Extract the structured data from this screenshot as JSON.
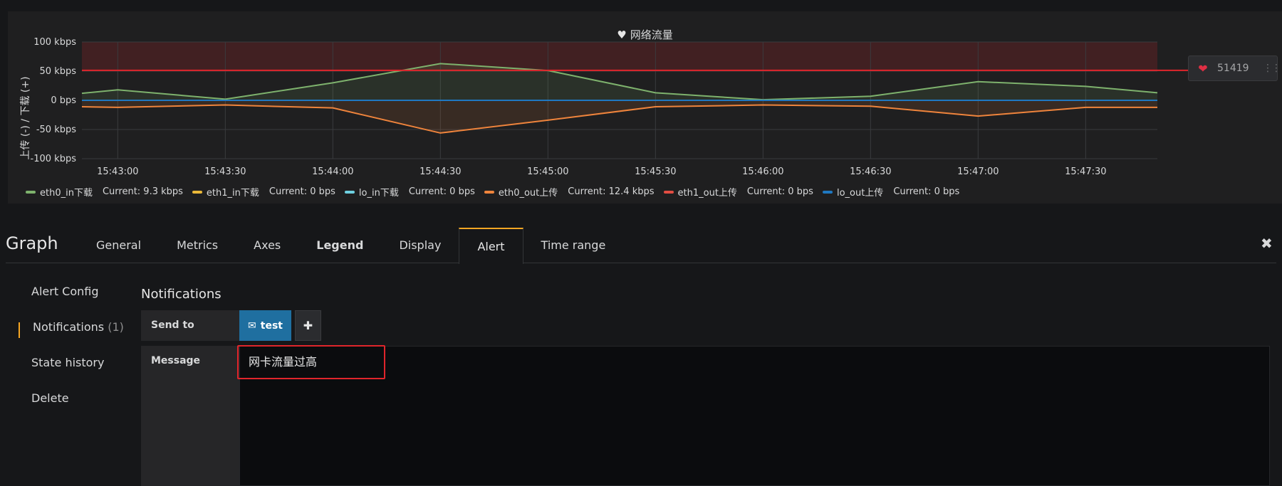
{
  "panel": {
    "title": "网络流量",
    "title_icon": "heart-icon",
    "y_axis_label": "上传 (-) / 下载 (+)",
    "threshold_handle": {
      "value": "51419",
      "icon": "broken-heart-icon"
    }
  },
  "chart_data": {
    "type": "line",
    "title": "网络流量",
    "ylabel": "上传 (-) / 下载 (+)",
    "xlabel": "",
    "ylim": [
      -100,
      100
    ],
    "y_ticks": [
      {
        "value": 100,
        "label": "100 kbps"
      },
      {
        "value": 50,
        "label": "50 kbps"
      },
      {
        "value": 0,
        "label": "0 bps"
      },
      {
        "value": -50,
        "label": "-50 kbps"
      },
      {
        "value": -100,
        "label": "-100 kbps"
      }
    ],
    "x_ticks": [
      "15:43:00",
      "15:43:30",
      "15:44:00",
      "15:44:30",
      "15:45:00",
      "15:45:30",
      "15:46:00",
      "15:46:30",
      "15:47:00",
      "15:47:30"
    ],
    "x_points": [
      "15:42:50",
      "15:43:00",
      "15:43:30",
      "15:44:00",
      "15:44:30",
      "15:45:00",
      "15:45:30",
      "15:46:00",
      "15:46:30",
      "15:47:00",
      "15:47:30",
      "15:47:50"
    ],
    "threshold": 51.4,
    "threshold_color": "#e0252b",
    "grid": true,
    "legend_position": "bottom",
    "series": [
      {
        "name": "eth0_in下载",
        "color": "#7eb26d",
        "current": "Current: 9.3 kbps",
        "fill": true,
        "values": [
          12,
          18,
          2,
          30,
          63,
          51,
          13,
          1,
          7,
          32,
          24,
          13
        ]
      },
      {
        "name": "eth1_in下载",
        "color": "#eab839",
        "current": "Current: 0 bps",
        "fill": false,
        "values": [
          0,
          0,
          0,
          0,
          0,
          0,
          0,
          0,
          0,
          0,
          0,
          0
        ]
      },
      {
        "name": "lo_in下载",
        "color": "#6ed0e0",
        "current": "Current: 0 bps",
        "fill": false,
        "values": [
          0,
          0,
          0,
          0,
          0,
          0,
          0,
          0,
          0,
          0,
          0,
          0
        ]
      },
      {
        "name": "eth0_out上传",
        "color": "#ef843c",
        "current": "Current: 12.4 kbps",
        "fill": true,
        "values": [
          -11,
          -12,
          -8,
          -13,
          -56,
          -34,
          -11,
          -8,
          -10,
          -27,
          -12,
          -12
        ]
      },
      {
        "name": "eth1_out上传",
        "color": "#e24d42",
        "current": "Current: 0 bps",
        "fill": false,
        "values": [
          0,
          0,
          0,
          0,
          0,
          0,
          0,
          0,
          0,
          0,
          0,
          0
        ]
      },
      {
        "name": "lo_out上传",
        "color": "#1f78c1",
        "current": "Current: 0 bps",
        "fill": false,
        "values": [
          0,
          0,
          0,
          0,
          0,
          0,
          0,
          0,
          0,
          0,
          0,
          0
        ]
      }
    ]
  },
  "editor": {
    "title": "Graph",
    "tabs": [
      "General",
      "Metrics",
      "Axes",
      "Legend",
      "Display",
      "Alert",
      "Time range"
    ],
    "active_tab": "Alert",
    "close_icon": "close-icon"
  },
  "side_nav": {
    "items": [
      {
        "label": "Alert Config",
        "count": ""
      },
      {
        "label": "Notifications",
        "count": "(1)"
      },
      {
        "label": "State history",
        "count": ""
      },
      {
        "label": "Delete",
        "count": ""
      }
    ],
    "active": "Notifications"
  },
  "notifications": {
    "section_title": "Notifications",
    "send_to_label": "Send to",
    "channel": {
      "label": "test",
      "icon": "envelope-icon"
    },
    "add_icon": "plus-icon",
    "message_label": "Message",
    "message_value": "网卡流量过高"
  }
}
